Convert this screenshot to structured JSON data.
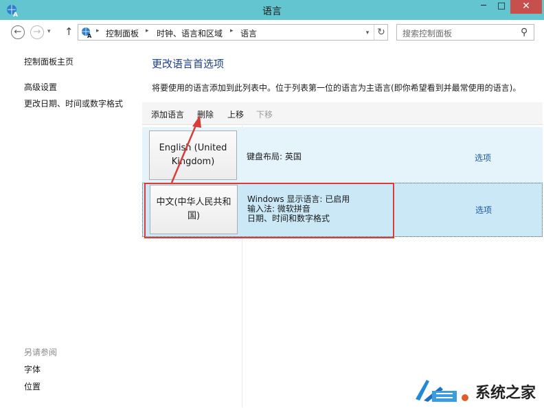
{
  "window": {
    "title": "语言",
    "minimize_label": "─",
    "maximize_label": "□",
    "close_label": "✕"
  },
  "nav": {
    "back_label": "←",
    "forward_label": "→",
    "history_label": "▾",
    "up_label": "↑",
    "breadcrumb": [
      "控制面板",
      "时钟、语言和区域",
      "语言"
    ],
    "breadcrumb_sep": "▸",
    "dropdown_label": "▾",
    "refresh_label": "↻",
    "search_placeholder": "搜索控制面板",
    "search_icon_label": "⚲"
  },
  "sidebar": {
    "home": "控制面板主页",
    "links": [
      "高级设置",
      "更改日期、时间或数字格式"
    ],
    "see_also_title": "另请参阅",
    "see_also": [
      "字体",
      "位置"
    ]
  },
  "main": {
    "heading": "更改语言首选项",
    "description": "将要使用的语言添加到此列表中。位于列表第一位的语言为主语言(即你希望看到并最常使用的语言)。",
    "toolbar": {
      "add": "添加语言",
      "remove": "删除",
      "move_up": "上移",
      "move_down": "下移"
    },
    "languages": [
      {
        "name": "English (United Kingdom)",
        "details": [
          "键盘布局: 英国"
        ],
        "options": "选项"
      },
      {
        "name": "中文(中华人民共和国)",
        "details": [
          "Windows 显示语言: 已启用",
          "输入法: 微软拼音",
          "日期、时间和数字格式"
        ],
        "options": "选项"
      }
    ]
  },
  "watermark": {
    "text": "系统之家"
  },
  "colors": {
    "titlebar": "#62c5cf",
    "close_button": "#c7504d",
    "heading": "#1b3e8a",
    "link": "#1b58a8",
    "row_hover": "#e5f3fb",
    "row_selected": "#cbe8f6",
    "annotation": "#d93a3a"
  }
}
